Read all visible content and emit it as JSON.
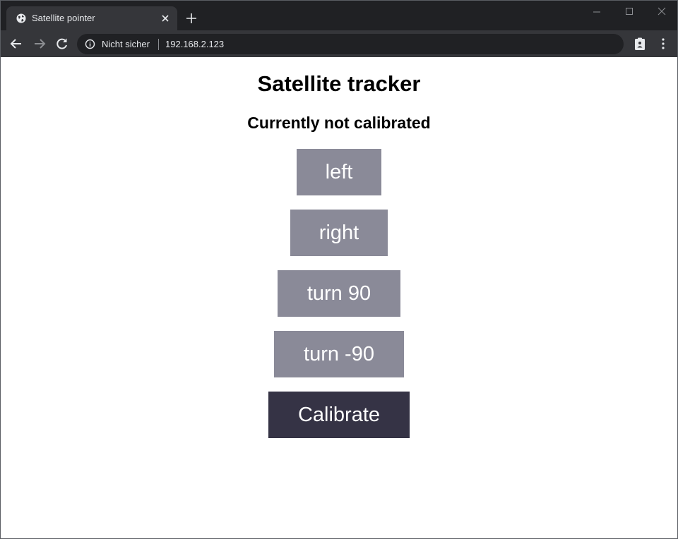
{
  "browser": {
    "tab": {
      "title": "Satellite pointer"
    },
    "address_bar": {
      "security_label": "Nicht sicher",
      "url": "192.168.2.123"
    }
  },
  "page": {
    "title": "Satellite tracker",
    "status": "Currently not calibrated",
    "buttons": {
      "left": "left",
      "right": "right",
      "turn90": "turn 90",
      "turn_minus90": "turn -90",
      "calibrate": "Calibrate"
    }
  },
  "colors": {
    "button_gray": "#8a8a98",
    "button_dark": "#353345",
    "chrome_dark": "#202124",
    "chrome_toolbar": "#35363a"
  }
}
